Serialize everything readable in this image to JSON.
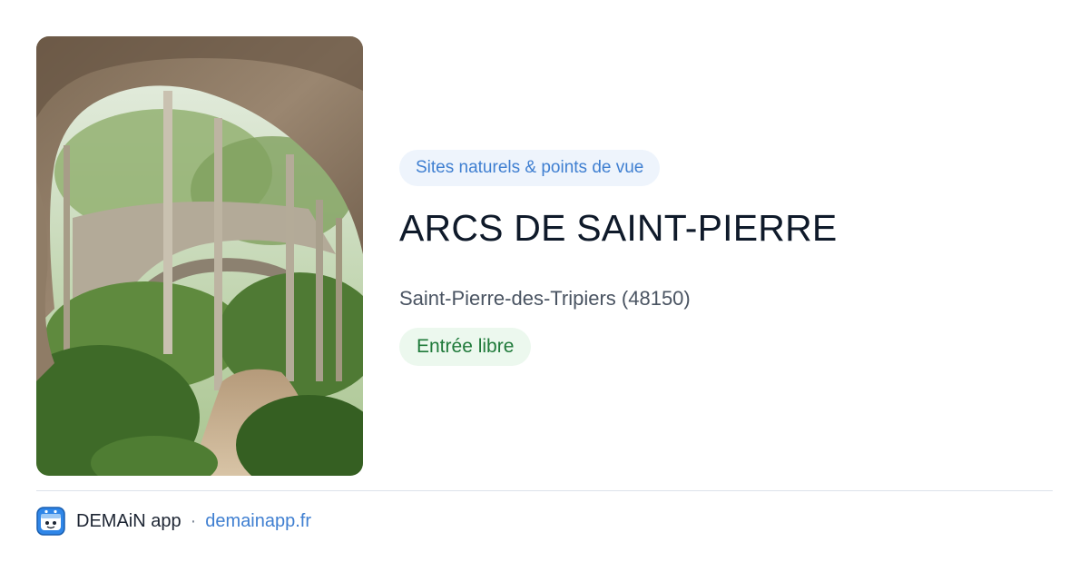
{
  "listing": {
    "category": "Sites naturels & points de vue",
    "title": "ARCS DE SAINT-PIERRE",
    "location": "Saint-Pierre-des-Tripiers (48150)",
    "access": "Entrée libre"
  },
  "footer": {
    "app_name": "DEMAiN app",
    "separator": "·",
    "domain": "demainapp.fr"
  },
  "icons": {
    "app": "demain-app-icon"
  },
  "colors": {
    "accent_blue": "#3f7fd1",
    "category_bg": "#eef4fc",
    "access_green": "#1f7a3a",
    "access_bg": "#ecf8ee",
    "title": "#0f1a2a"
  }
}
